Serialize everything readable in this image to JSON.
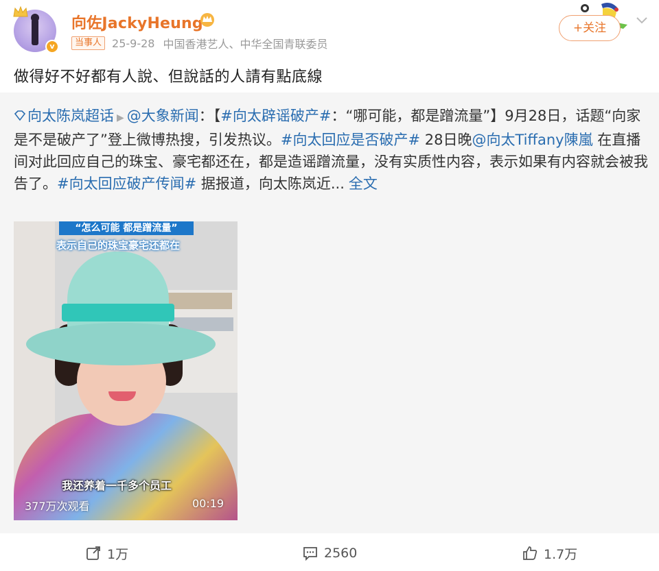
{
  "header": {
    "username": "向佐JackyHeung",
    "badge": "当事人",
    "date": "25-9-28",
    "description": "中国香港艺人、中华全国青联委员",
    "follow_label": "+关注"
  },
  "post": {
    "text": "做得好不好都有人說、但說話的人請有點底線"
  },
  "repost": {
    "supertopic": "向太陈岚超话",
    "source": "@大象新闻",
    "colon": "：",
    "bracket_open": "【",
    "topic1": "#向太辟谣破产#",
    "quote": "：“哪可能，都是蹭流量”】9月28日，话题“向家是不是破产了”登上微博热搜，引发热议。",
    "topic2": "#向太回应是否破产#",
    "text2": " 28日晚",
    "mention": "@向太Tiffany陳嵐",
    "text3": " 在直播间对此回应自己的珠宝、豪宅都还在，都是造谣蹭流量，没有实质性内容，表示如果有内容就会被我告了。",
    "topic3": "#向太回应破产传闻#",
    "text4": " 据报道，向太陈岚近...",
    "more": "全文"
  },
  "video": {
    "caption_top1": "“怎么可能 都是蹭流量”",
    "caption_top2": "表示自己的珠宝豪宅还都在",
    "caption_bottom": "我还养着一千多个员工",
    "views": "377万次观看",
    "duration": "00:19"
  },
  "actions": {
    "repost_count": "1万",
    "comment_count": "2560",
    "like_count": "1.7万"
  },
  "colors": {
    "accent": "#e8752a",
    "link": "#2a6db0",
    "repost_bg": "#f5f5f5"
  }
}
